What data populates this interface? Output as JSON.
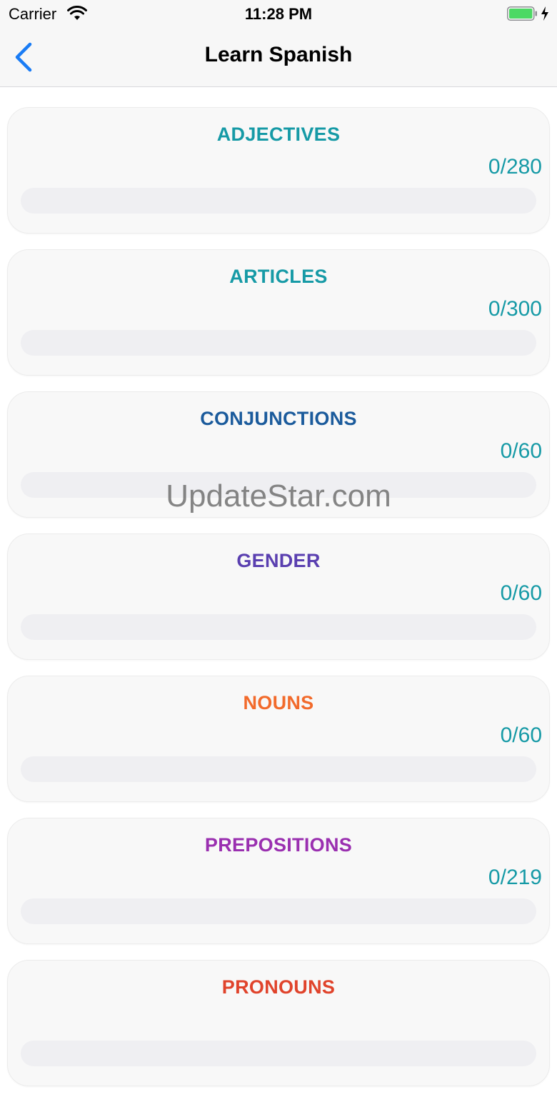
{
  "status_bar": {
    "carrier": "Carrier",
    "time": "11:28 PM",
    "battery_color": "#4cd964"
  },
  "nav_bar": {
    "title": "Learn Spanish",
    "back_icon": "chevron-left-icon",
    "accent": "#1a7cf5"
  },
  "categories": [
    {
      "title": "ADJECTIVES",
      "count": "0/280",
      "progress": 0,
      "title_color": "#169aa6",
      "count_color": "#169aa6"
    },
    {
      "title": "ARTICLES",
      "count": "0/300",
      "progress": 0,
      "title_color": "#169aa6",
      "count_color": "#169aa6"
    },
    {
      "title": "CONJUNCTIONS",
      "count": "0/60",
      "progress": 0,
      "title_color": "#1b5b9c",
      "count_color": "#169aa6"
    },
    {
      "title": "GENDER",
      "count": "0/60",
      "progress": 0,
      "title_color": "#5a3fb0",
      "count_color": "#169aa6"
    },
    {
      "title": "NOUNS",
      "count": "0/60",
      "progress": 0,
      "title_color": "#f26a2b",
      "count_color": "#169aa6"
    },
    {
      "title": "PREPOSITIONS",
      "count": "0/219",
      "progress": 0,
      "title_color": "#9a2fb0",
      "count_color": "#169aa6"
    },
    {
      "title": "PRONOUNS",
      "count": "",
      "progress": 0,
      "title_color": "#e0432b",
      "count_color": "#169aa6"
    }
  ],
  "watermark": "UpdateStar.com"
}
